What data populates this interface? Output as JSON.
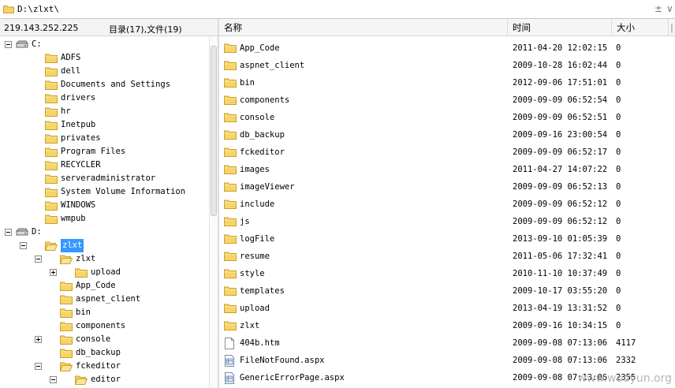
{
  "address": {
    "path": "D:\\zlxt\\",
    "minimize_glyph": "±",
    "arrow_glyph": "∨"
  },
  "info": {
    "ip": "219.143.252.225",
    "counts": "目录(17),文件(19)"
  },
  "columns": {
    "name": "名称",
    "time": "时间",
    "size": "大小",
    "extra": "|"
  },
  "tree": [
    {
      "label": "C:",
      "level": 0,
      "kind": "drive",
      "toggle": "minus"
    },
    {
      "label": "ADFS",
      "level": 1,
      "kind": "folder"
    },
    {
      "label": "dell",
      "level": 1,
      "kind": "folder"
    },
    {
      "label": "Documents and Settings",
      "level": 1,
      "kind": "folder"
    },
    {
      "label": "drivers",
      "level": 1,
      "kind": "folder"
    },
    {
      "label": "hr",
      "level": 1,
      "kind": "folder"
    },
    {
      "label": "Inetpub",
      "level": 1,
      "kind": "folder"
    },
    {
      "label": "privates",
      "level": 1,
      "kind": "folder"
    },
    {
      "label": "Program Files",
      "level": 1,
      "kind": "folder"
    },
    {
      "label": "RECYCLER",
      "level": 1,
      "kind": "folder"
    },
    {
      "label": "serveradministrator",
      "level": 1,
      "kind": "folder"
    },
    {
      "label": "System Volume Information",
      "level": 1,
      "kind": "folder"
    },
    {
      "label": "WINDOWS",
      "level": 1,
      "kind": "folder"
    },
    {
      "label": "wmpub",
      "level": 1,
      "kind": "folder"
    },
    {
      "label": "D:",
      "level": 0,
      "kind": "drive",
      "toggle": "minus"
    },
    {
      "label": "zlxt",
      "level": 1,
      "kind": "folder-open",
      "toggle": "minus",
      "selected": true
    },
    {
      "label": "zlxt",
      "level": 2,
      "kind": "folder-open",
      "toggle": "minus"
    },
    {
      "label": "upload",
      "level": 3,
      "kind": "folder",
      "toggle": "plus"
    },
    {
      "label": "App_Code",
      "level": 2,
      "kind": "folder"
    },
    {
      "label": "aspnet_client",
      "level": 2,
      "kind": "folder"
    },
    {
      "label": "bin",
      "level": 2,
      "kind": "folder"
    },
    {
      "label": "components",
      "level": 2,
      "kind": "folder"
    },
    {
      "label": "console",
      "level": 2,
      "kind": "folder",
      "toggle": "plus"
    },
    {
      "label": "db_backup",
      "level": 2,
      "kind": "folder"
    },
    {
      "label": "fckeditor",
      "level": 2,
      "kind": "folder-open",
      "toggle": "minus"
    },
    {
      "label": "editor",
      "level": 3,
      "kind": "folder-open",
      "toggle": "minus"
    }
  ],
  "files": [
    {
      "name": "App_Code",
      "time": "2011-04-20 12:02:15",
      "size": "0",
      "kind": "folder"
    },
    {
      "name": "aspnet_client",
      "time": "2009-10-28 16:02:44",
      "size": "0",
      "kind": "folder"
    },
    {
      "name": "bin",
      "time": "2012-09-06 17:51:01",
      "size": "0",
      "kind": "folder"
    },
    {
      "name": "components",
      "time": "2009-09-09 06:52:54",
      "size": "0",
      "kind": "folder"
    },
    {
      "name": "console",
      "time": "2009-09-09 06:52:51",
      "size": "0",
      "kind": "folder"
    },
    {
      "name": "db_backup",
      "time": "2009-09-16 23:00:54",
      "size": "0",
      "kind": "folder"
    },
    {
      "name": "fckeditor",
      "time": "2009-09-09 06:52:17",
      "size": "0",
      "kind": "folder"
    },
    {
      "name": "images",
      "time": "2011-04-27 14:07:22",
      "size": "0",
      "kind": "folder"
    },
    {
      "name": "imageViewer",
      "time": "2009-09-09 06:52:13",
      "size": "0",
      "kind": "folder"
    },
    {
      "name": "include",
      "time": "2009-09-09 06:52:12",
      "size": "0",
      "kind": "folder"
    },
    {
      "name": "js",
      "time": "2009-09-09 06:52:12",
      "size": "0",
      "kind": "folder"
    },
    {
      "name": "logFile",
      "time": "2013-09-10 01:05:39",
      "size": "0",
      "kind": "folder"
    },
    {
      "name": "resume",
      "time": "2011-05-06 17:32:41",
      "size": "0",
      "kind": "folder"
    },
    {
      "name": "style",
      "time": "2010-11-10 10:37:49",
      "size": "0",
      "kind": "folder"
    },
    {
      "name": "templates",
      "time": "2009-10-17 03:55:20",
      "size": "0",
      "kind": "folder"
    },
    {
      "name": "upload",
      "time": "2013-04-19 13:31:52",
      "size": "0",
      "kind": "folder"
    },
    {
      "name": "zlxt",
      "time": "2009-09-16 10:34:15",
      "size": "0",
      "kind": "folder"
    },
    {
      "name": "404b.htm",
      "time": "2009-09-08 07:13:06",
      "size": "4117",
      "kind": "file"
    },
    {
      "name": "FileNotFound.aspx",
      "time": "2009-09-08 07:13:06",
      "size": "2332",
      "kind": "aspx"
    },
    {
      "name": "GenericErrorPage.aspx",
      "time": "2009-09-08 07:13:06",
      "size": "2355",
      "kind": "aspx"
    }
  ],
  "watermark": "www.wooyun.org",
  "colors": {
    "folder": "#f5d46a",
    "folder_edge": "#c9a227",
    "selection": "#3399ff"
  }
}
